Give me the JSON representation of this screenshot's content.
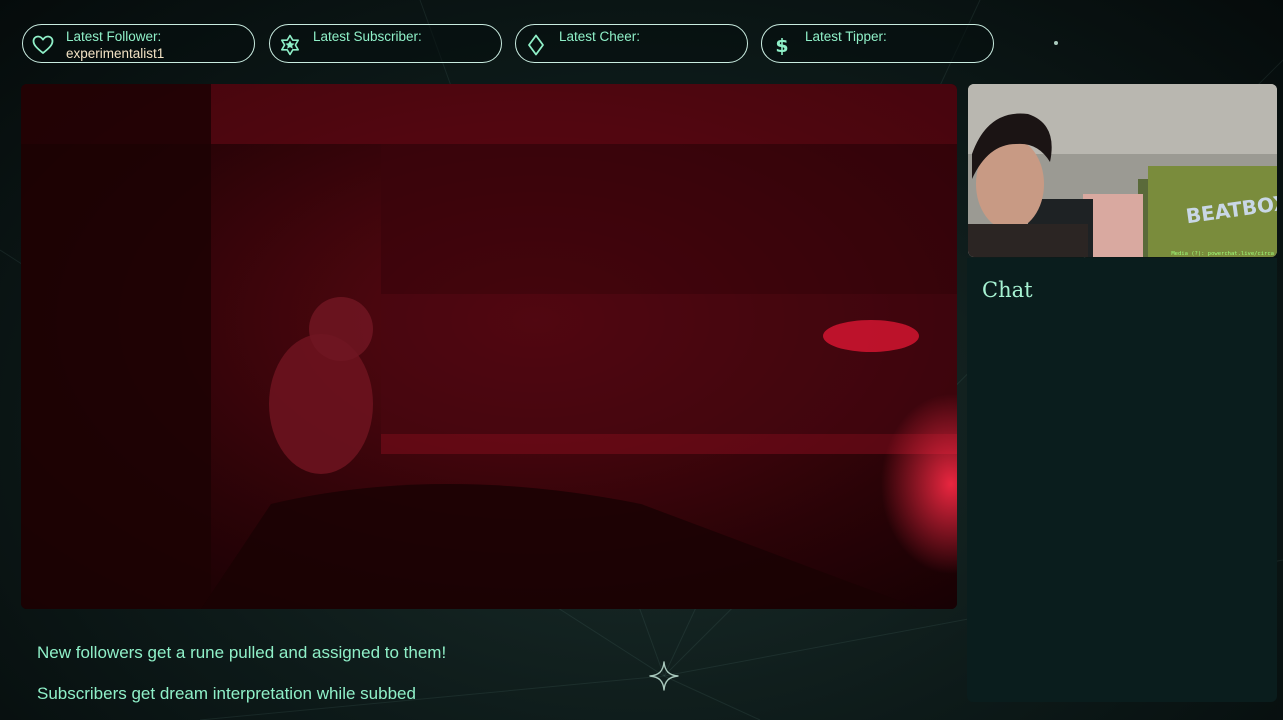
{
  "alerts": [
    {
      "label": "Latest Follower:",
      "value": "experimentalist1",
      "icon": "heart-icon"
    },
    {
      "label": "Latest Subscriber:",
      "value": "",
      "icon": "star-icon"
    },
    {
      "label": "Latest Cheer:",
      "value": "",
      "icon": "diamond-icon"
    },
    {
      "label": "Latest Tipper:",
      "value": "",
      "icon": "dollar-icon"
    }
  ],
  "facecam": {
    "overlay_text": "Media (?): powerchat.live/circa",
    "poster_text": "BEATBOX"
  },
  "chat": {
    "title": "Chat"
  },
  "info": {
    "line1": "New followers get a rune pulled and assigned to them!",
    "line2": "Subscribers get dream interpretation while subbed"
  },
  "colors": {
    "accent": "#8ff0c8",
    "value_text": "#f3e3c5",
    "background": "#0d1a19",
    "chat_panel": "#0a1d1d",
    "border": "#c9ece0"
  }
}
